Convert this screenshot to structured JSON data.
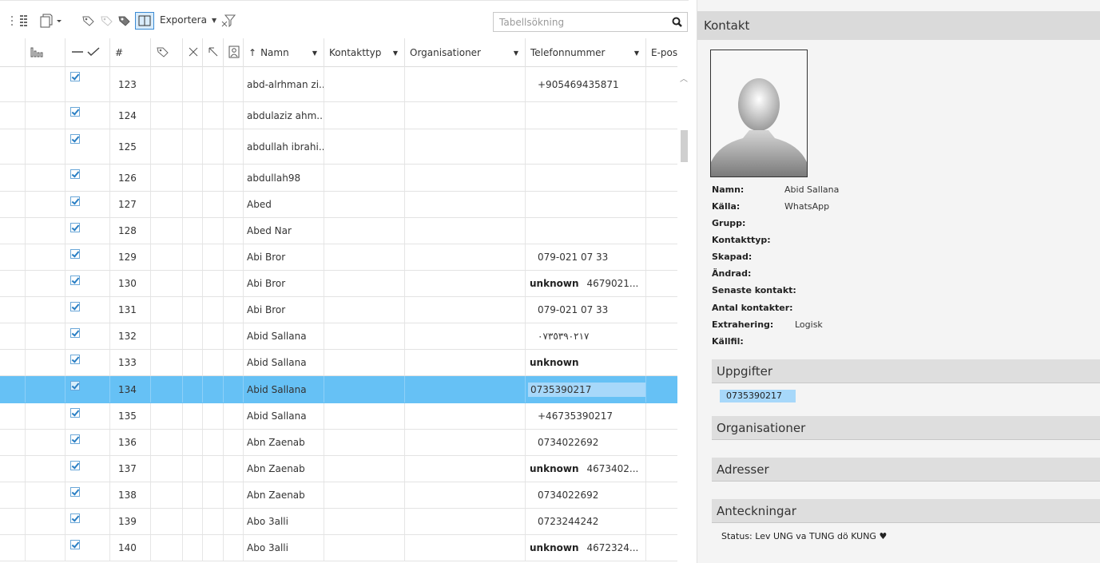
{
  "toolbar": {
    "export_label": "Exportera",
    "search_placeholder": "Tabellsökning",
    "icons": [
      "columns-icon",
      "copy-icon",
      "tag-icon",
      "tag-disabled-icon",
      "tag-settings-icon",
      "panel-icon",
      "filter-clear-icon",
      "search-icon"
    ]
  },
  "table": {
    "columns": {
      "number": "#",
      "name": "Namn",
      "contact_type": "Kontakttyp",
      "organisations": "Organisationer",
      "phone": "Telefonnummer",
      "email": "E-pos"
    },
    "rows": [
      {
        "id": "123",
        "name": "abd-alrhman zi...",
        "phone_tag": "",
        "phone": "+905469435871"
      },
      {
        "id": "124",
        "name": "abdulaziz ahm...",
        "phone_tag": "",
        "phone": ""
      },
      {
        "id": "125",
        "name": "abdullah ibrahi...",
        "phone_tag": "",
        "phone": ""
      },
      {
        "id": "126",
        "name": "abdullah98",
        "phone_tag": "",
        "phone": ""
      },
      {
        "id": "127",
        "name": "Abed",
        "phone_tag": "",
        "phone": ""
      },
      {
        "id": "128",
        "name": "Abed Nar",
        "phone_tag": "",
        "phone": ""
      },
      {
        "id": "129",
        "name": "Abi Bror",
        "phone_tag": "",
        "phone": "079-021 07 33"
      },
      {
        "id": "130",
        "name": "Abi Bror",
        "phone_tag": "unknown",
        "phone": "4679021..."
      },
      {
        "id": "131",
        "name": "Abi Bror",
        "phone_tag": "",
        "phone": "079-021 07 33"
      },
      {
        "id": "132",
        "name": "Abid Sallana",
        "phone_tag": "",
        "phone": "٠٧٣٥٣٩٠٢١٧"
      },
      {
        "id": "133",
        "name": "Abid Sallana",
        "phone_tag": "unknown",
        "phone": ""
      },
      {
        "id": "134",
        "name": "Abid Sallana",
        "phone_tag": "",
        "phone": "0735390217",
        "selected": true
      },
      {
        "id": "135",
        "name": "Abid Sallana",
        "phone_tag": "",
        "phone": "+46735390217"
      },
      {
        "id": "136",
        "name": "Abn Zaenab",
        "phone_tag": "",
        "phone": "0734022692"
      },
      {
        "id": "137",
        "name": "Abn Zaenab",
        "phone_tag": "unknown",
        "phone": "4673402..."
      },
      {
        "id": "138",
        "name": "Abn Zaenab",
        "phone_tag": "",
        "phone": "0734022692"
      },
      {
        "id": "139",
        "name": "Abo 3alli",
        "phone_tag": "",
        "phone": "0723244242"
      },
      {
        "id": "140",
        "name": "Abo 3alli",
        "phone_tag": "unknown",
        "phone": "4672324..."
      }
    ]
  },
  "contact": {
    "title": "Kontakt",
    "fields": [
      {
        "label": "Namn:",
        "value": "Abid Sallana"
      },
      {
        "label": "Källa:",
        "value": "WhatsApp"
      },
      {
        "label": "Grupp:",
        "value": ""
      },
      {
        "label": "Kontakttyp:",
        "value": ""
      },
      {
        "label": "Skapad:",
        "value": ""
      },
      {
        "label": "Ändrad:",
        "value": ""
      },
      {
        "label": "Senaste kontakt:",
        "value": ""
      },
      {
        "label": "Antal kontakter:",
        "value": ""
      },
      {
        "label": "Extrahering:",
        "value": "Logisk"
      },
      {
        "label": "Källfil:",
        "value": ""
      }
    ],
    "sections": {
      "details": "Uppgifter",
      "organisations": "Organisationer",
      "addresses": "Adresser",
      "notes": "Anteckningar"
    },
    "detail_phone": "0735390217",
    "notes_text": "Status: Lev UNG va TUNG dö KUNG ♥"
  },
  "colors": {
    "selection": "#66c1f5",
    "phone_highlight": "#a7d8fa",
    "checkbox": "#2a7fc4"
  }
}
